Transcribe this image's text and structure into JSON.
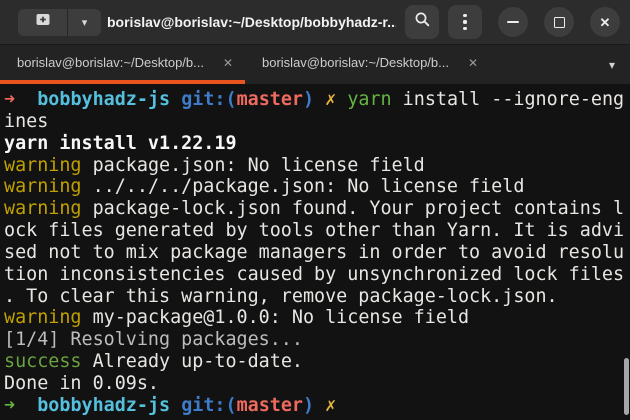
{
  "colors": {
    "accent": "#e95420",
    "titlebar_bg": "#2c2c2c",
    "tabbar_bg": "#232323",
    "button_bg": "#3d3d3d",
    "terminal_bg": "#121212",
    "fg": "#e8e6e3",
    "bright": "#f7f7f7",
    "dim": "#bdbdbd",
    "red": "#ee6a5e",
    "green": "#64b442",
    "sgreen": "#6aa33f",
    "cyan": "#54c0dd",
    "blue": "#3e7cc9",
    "yellow": "#e6b33e",
    "wyellow": "#c0a000"
  },
  "titlebar": {
    "title": "borislav@borislav:~/Desktop/bobbyhadz-r...",
    "icons": {
      "caret_down": "▾",
      "close": "✕"
    }
  },
  "tabbar": {
    "tabs": [
      {
        "label": "borislav@borislav:~/Desktop/b...",
        "close_icon": "✕",
        "active": true
      },
      {
        "label": "borislav@borislav:~/Desktop/b...",
        "close_icon": "✕",
        "active": false
      }
    ],
    "overflow_caret": "▾"
  },
  "terminal": {
    "columns": 56,
    "lines": [
      [
        [
          "➜",
          "red",
          true
        ],
        [
          "  ",
          "fg",
          false
        ],
        [
          "bobbyhadz-js",
          "cyan",
          true
        ],
        [
          " ",
          "fg",
          false
        ],
        [
          "git:(",
          "blue",
          true
        ],
        [
          "master",
          "red",
          true
        ],
        [
          ")",
          "blue",
          true
        ],
        [
          " ",
          "fg",
          false
        ],
        [
          "✗",
          "yellow",
          true
        ],
        [
          " ",
          "fg",
          false
        ],
        [
          "yarn",
          "green",
          false
        ],
        [
          " install --ignore-eng",
          "fg",
          false
        ]
      ],
      [
        [
          "ines",
          "fg",
          false
        ]
      ],
      [
        [
          "yarn install v1.22.19",
          "bright",
          true
        ]
      ],
      [
        [
          "warning",
          "wyellow",
          false
        ],
        [
          " package.json: No license field",
          "fg",
          false
        ]
      ],
      [
        [
          "warning",
          "wyellow",
          false
        ],
        [
          " ../../../package.json: No license field",
          "fg",
          false
        ]
      ],
      [
        [
          "warning",
          "wyellow",
          false
        ],
        [
          " package-lock.json found. Your project contains l",
          "fg",
          false
        ]
      ],
      [
        [
          "ock files generated by tools other than Yarn. It is advi",
          "fg",
          false
        ]
      ],
      [
        [
          "sed not to mix package managers in order to avoid resolu",
          "fg",
          false
        ]
      ],
      [
        [
          "tion inconsistencies caused by unsynchronized lock files",
          "fg",
          false
        ]
      ],
      [
        [
          ". To clear this warning, remove package-lock.json.",
          "fg",
          false
        ]
      ],
      [
        [
          "warning",
          "wyellow",
          false
        ],
        [
          " my-package@1.0.0: No license field",
          "fg",
          false
        ]
      ],
      [
        [
          "[1/4] Resolving packages...",
          "dim",
          false
        ]
      ],
      [
        [
          "success",
          "sgreen",
          false
        ],
        [
          " Already up-to-date.",
          "fg",
          false
        ]
      ],
      [
        [
          "Done in 0.09s.",
          "fg",
          false
        ]
      ],
      [
        [
          "➜",
          "green",
          true
        ],
        [
          "  ",
          "fg",
          false
        ],
        [
          "bobbyhadz-js",
          "cyan",
          true
        ],
        [
          " ",
          "fg",
          false
        ],
        [
          "git:(",
          "blue",
          true
        ],
        [
          "master",
          "red",
          true
        ],
        [
          ")",
          "blue",
          true
        ],
        [
          " ",
          "fg",
          false
        ],
        [
          "✗",
          "yellow",
          true
        ]
      ]
    ]
  }
}
